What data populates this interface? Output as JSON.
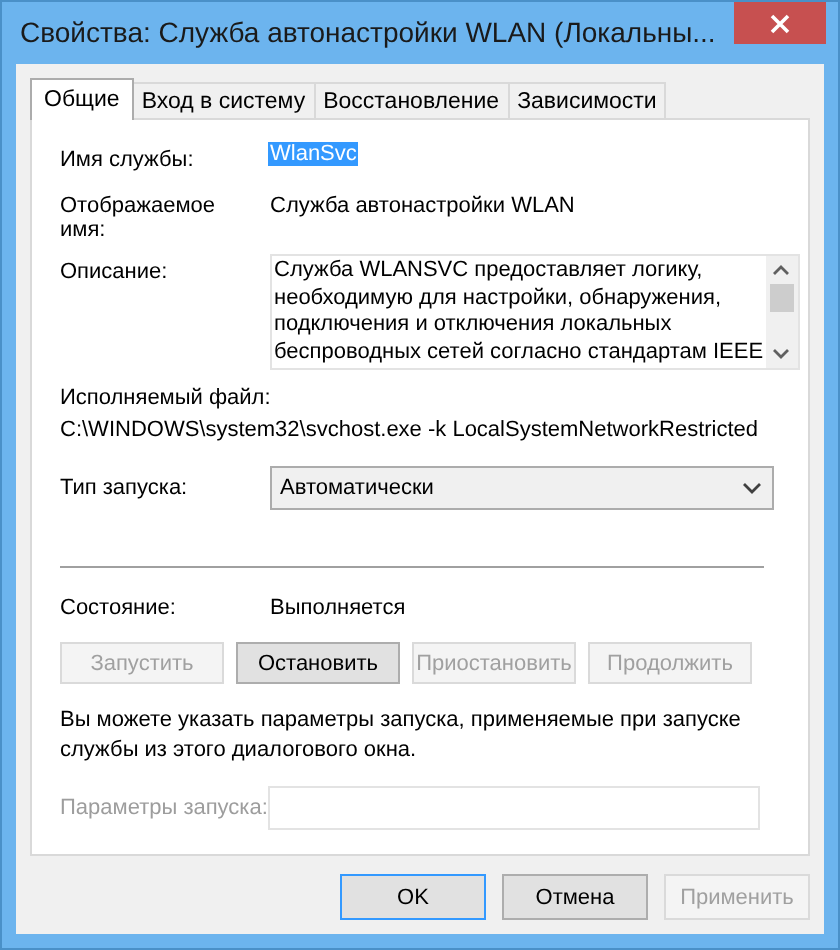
{
  "window": {
    "title": "Свойства: Служба автонастройки WLAN (Локальны..."
  },
  "tabs": [
    {
      "label": "Общие",
      "selected": true
    },
    {
      "label": "Вход в систему",
      "selected": false
    },
    {
      "label": "Восстановление",
      "selected": false
    },
    {
      "label": "Зависимости",
      "selected": false
    }
  ],
  "service_name": {
    "label": "Имя службы:",
    "value": "WlanSvc",
    "selected": true
  },
  "display_name": {
    "label": "Отображаемое имя:",
    "value": "Служба автонастройки WLAN"
  },
  "description": {
    "label": "Описание:",
    "lines": [
      "Служба WLANSVC предоставляет логику,",
      "необходимую для настройки, обнаружения,",
      "подключения и отключения локальных",
      "беспроводных сетей согласно стандартам IEEE"
    ]
  },
  "executable": {
    "label": "Исполняемый файл:",
    "path": "C:\\WINDOWS\\system32\\svchost.exe -k LocalSystemNetworkRestricted"
  },
  "startup_type": {
    "label": "Тип запуска:",
    "value": "Автоматически"
  },
  "status": {
    "label": "Состояние:",
    "value": "Выполняется"
  },
  "service_buttons": [
    {
      "label": "Запустить",
      "disabled": true
    },
    {
      "label": "Остановить",
      "disabled": false
    },
    {
      "label": "Приостановить",
      "disabled": true
    },
    {
      "label": "Продолжить",
      "disabled": true
    }
  ],
  "note": "Вы можете указать параметры запуска, применяемые при запуске службы из этого диалогового окна.",
  "start_params": {
    "label": "Параметры запуска:",
    "disabled": true
  },
  "dialog_buttons": [
    {
      "label": "OK",
      "disabled": false,
      "default": true
    },
    {
      "label": "Отмена",
      "disabled": false,
      "default": false
    },
    {
      "label": "Применить",
      "disabled": true,
      "default": false
    }
  ]
}
